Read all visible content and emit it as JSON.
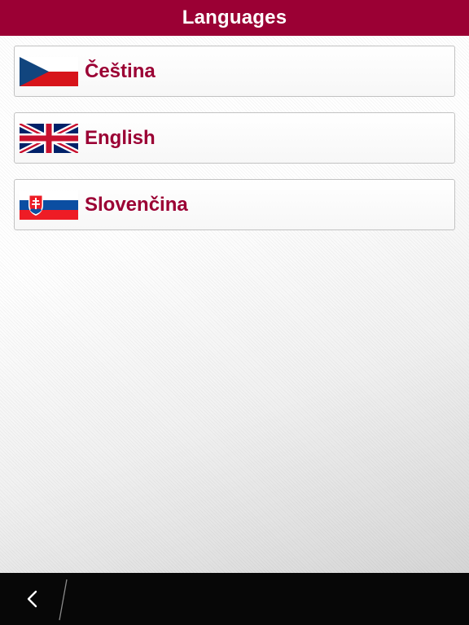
{
  "header": {
    "title": "Languages"
  },
  "languages": [
    {
      "label": "Čeština",
      "flag_icon": "czech-flag-icon"
    },
    {
      "label": "English",
      "flag_icon": "uk-flag-icon"
    },
    {
      "label": "Slovenčina",
      "flag_icon": "slovak-flag-icon"
    }
  ],
  "footer": {
    "back_icon": "chevron-left-icon"
  },
  "colors": {
    "header_bg": "#9b0034",
    "label_text": "#9b0034",
    "footer_bg": "#070707"
  }
}
